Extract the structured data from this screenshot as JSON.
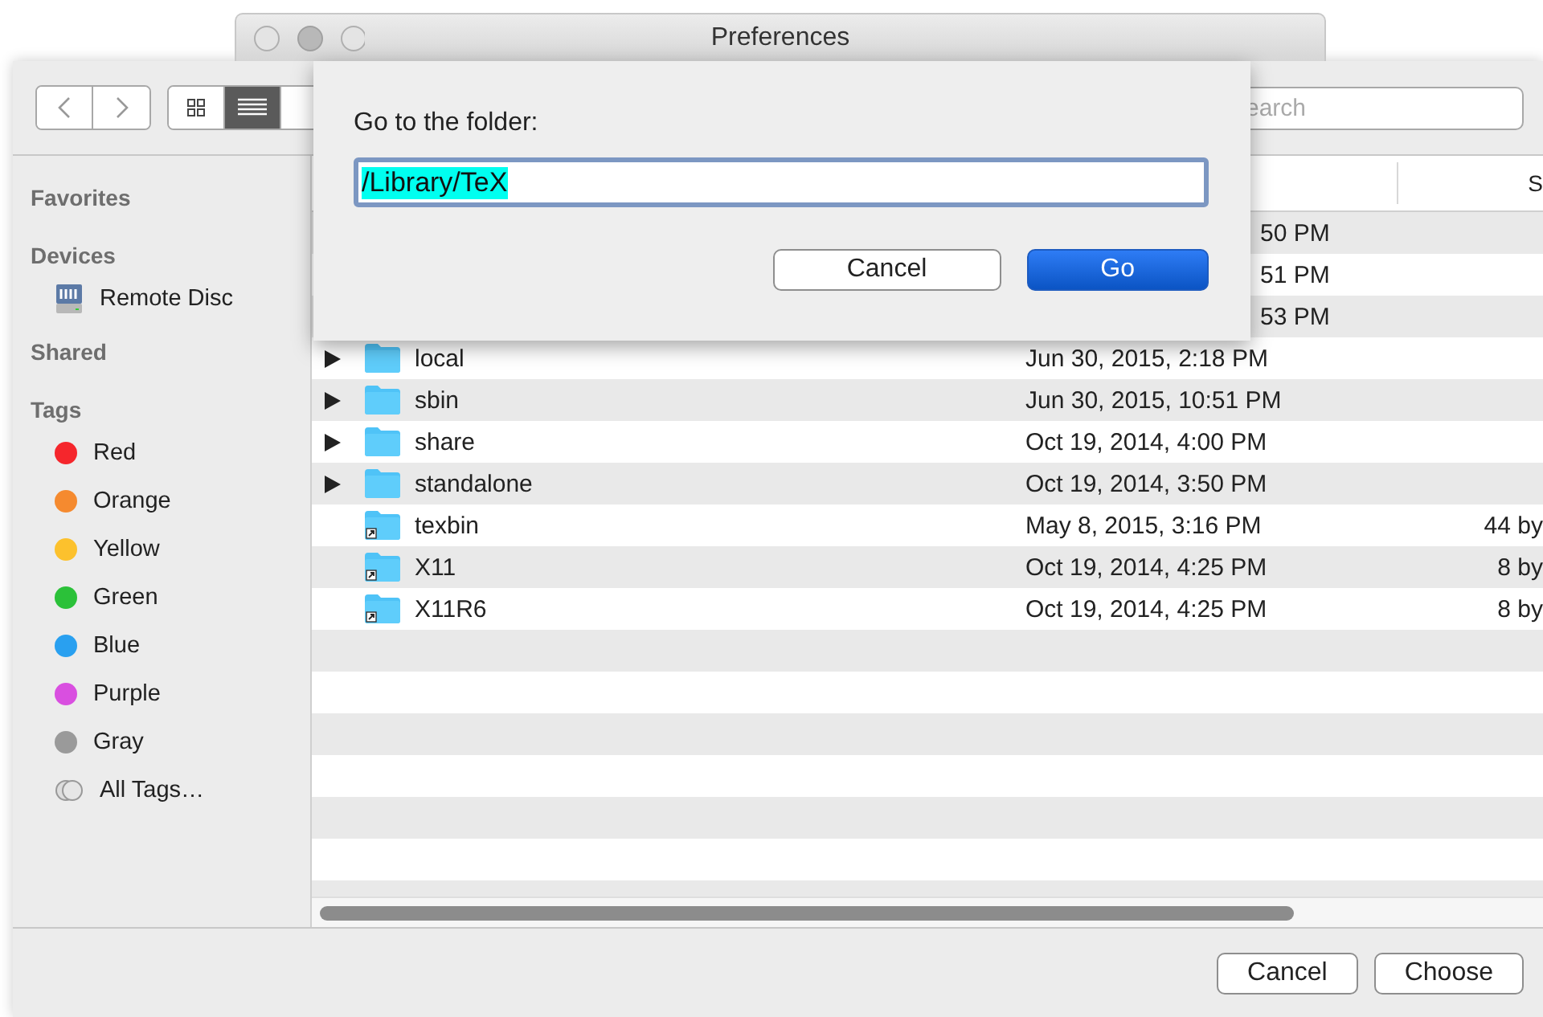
{
  "back_window": {
    "title": "Preferences"
  },
  "toolbar": {
    "search": {
      "placeholder": "earch"
    }
  },
  "sidebar": {
    "sections": [
      {
        "title": "Favorites"
      },
      {
        "title": "Devices",
        "items": [
          {
            "kind": "device",
            "label": "Remote Disc"
          }
        ]
      },
      {
        "title": "Shared"
      },
      {
        "title": "Tags",
        "items": [
          {
            "kind": "tag",
            "label": "Red",
            "color": "#f5262c"
          },
          {
            "kind": "tag",
            "label": "Orange",
            "color": "#f58a2f"
          },
          {
            "kind": "tag",
            "label": "Yellow",
            "color": "#fcc12d"
          },
          {
            "kind": "tag",
            "label": "Green",
            "color": "#2bc139"
          },
          {
            "kind": "tag",
            "label": "Blue",
            "color": "#29a0f0"
          },
          {
            "kind": "tag",
            "label": "Purple",
            "color": "#d94fe0"
          },
          {
            "kind": "tag",
            "label": "Gray",
            "color": "#9a9a9a"
          },
          {
            "kind": "all-tags",
            "label": "All Tags…"
          }
        ]
      }
    ]
  },
  "table": {
    "columns": [
      {
        "label": "S"
      }
    ],
    "rows": [
      {
        "date": "50 PM"
      },
      {
        "date": "51 PM"
      },
      {
        "date": "53 PM"
      },
      {
        "kind": "folder",
        "expandable": true,
        "name": "local",
        "date": "Jun 30, 2015, 2:18 PM"
      },
      {
        "kind": "folder",
        "expandable": true,
        "name": "sbin",
        "date": "Jun 30, 2015, 10:51 PM"
      },
      {
        "kind": "folder",
        "expandable": true,
        "name": "share",
        "date": "Oct 19, 2014, 4:00 PM"
      },
      {
        "kind": "folder",
        "expandable": true,
        "name": "standalone",
        "date": "Oct 19, 2014, 3:50 PM"
      },
      {
        "kind": "alias",
        "expandable": false,
        "name": "texbin",
        "date": "May 8, 2015, 3:16 PM",
        "size": "44 by"
      },
      {
        "kind": "alias",
        "expandable": false,
        "name": "X11",
        "date": "Oct 19, 2014, 4:25 PM",
        "size": "8 by"
      },
      {
        "kind": "alias",
        "expandable": false,
        "name": "X11R6",
        "date": "Oct 19, 2014, 4:25 PM",
        "size": "8 by"
      }
    ]
  },
  "footer": {
    "buttons": [
      "Cancel",
      "Choose"
    ]
  },
  "sheet": {
    "prompt": "Go to the folder:",
    "path": "/Library/TeX",
    "path_selected": true,
    "buttons": [
      {
        "label": "Cancel",
        "default": false
      },
      {
        "label": "Go",
        "default": true
      }
    ]
  }
}
